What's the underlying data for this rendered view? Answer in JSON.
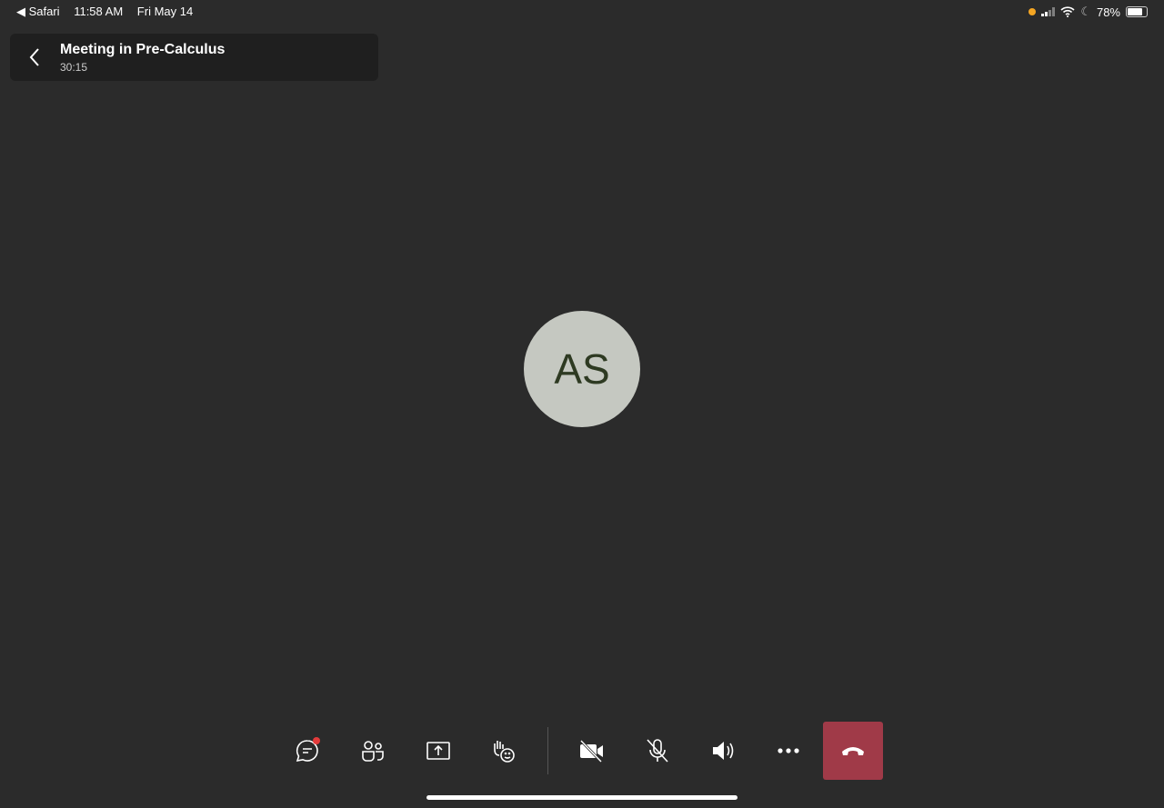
{
  "status_bar": {
    "back_app": "◀ Safari",
    "time": "11:58 AM",
    "date": "Fri May 14",
    "battery": "78%",
    "battery_level": 0.78
  },
  "header": {
    "title": "Meeting in Pre-Calculus",
    "timer": "30:15"
  },
  "participant": {
    "initials": "AS"
  },
  "colors": {
    "hangup": "#a03a48",
    "avatar": "#c5c8c1",
    "notification": "#e43b3b"
  }
}
